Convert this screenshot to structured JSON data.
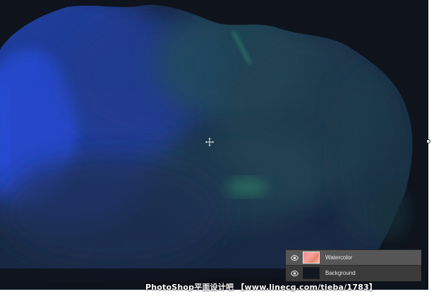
{
  "app": {
    "name": "Photoshop"
  },
  "document": {
    "background_color": "#0e131c",
    "paint_colors": [
      "#1c3cd6",
      "#163a8a",
      "#1b4d5a",
      "#2a6e56",
      "#38c58a"
    ]
  },
  "tools": {
    "cursor_icon": "move-cursor-icon",
    "transform_handle_icon": "transform-handle-icon"
  },
  "layers_panel": {
    "layers": [
      {
        "name": "Watercolor",
        "visible": true,
        "selected": true,
        "thumbnail": "watercolor-thumbnail",
        "eye_icon": "eye-icon"
      },
      {
        "name": "Background",
        "visible": true,
        "selected": false,
        "thumbnail": "background-thumbnail",
        "eye_icon": "eye-icon"
      }
    ],
    "selected_color": "#565656",
    "panel_color": "#3b3b3b"
  },
  "watermark": {
    "text": "PhotoShop平面设计吧 【www.linecg.com/tieba/1783】"
  }
}
